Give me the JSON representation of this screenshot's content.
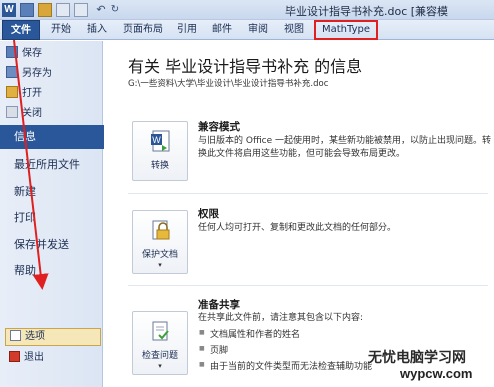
{
  "window": {
    "title": "毕业设计指导书补充.doc [兼容模"
  },
  "quick_access": {
    "logo": "W",
    "undo": "↶",
    "redo": "↻"
  },
  "ribbon_tabs": [
    "文件",
    "开始",
    "插入",
    "页面布局",
    "引用",
    "邮件",
    "审阅",
    "视图",
    "MathType"
  ],
  "backstage_nav": {
    "small_items": [
      "保存",
      "另存为",
      "打开",
      "关闭"
    ],
    "big_items": [
      "信息",
      "最近所用文件",
      "新建",
      "打印",
      "保存并发送",
      "帮助"
    ],
    "selected": "信息",
    "options_label": "选项",
    "exit_label": "退出"
  },
  "info": {
    "title": "有关 毕业设计指导书补充 的信息",
    "path": "G:\\一些资料\\大学\\毕业设计\\毕业设计指导书补充.doc",
    "compat": {
      "title": "兼容模式",
      "desc1": "与旧版本的 Office 一起使用时，某些新功能被禁用，以防止出现问题。转",
      "desc2": "换此文件将启用这些功能，但可能会导致布局更改。",
      "button_label": "转换"
    },
    "permissions": {
      "title": "权限",
      "desc": "任何人均可打开、复制和更改此文档的任何部分。",
      "button_label": "保护文档"
    },
    "prepare": {
      "title": "准备共享",
      "desc": "在共享此文件前，请注意其包含以下内容:",
      "bullets": [
        "文档属性和作者的姓名",
        "页脚",
        "由于当前的文件类型而无法检查辅助功能"
      ],
      "button_label": "检查问题"
    }
  },
  "watermark": {
    "cn": "无忧电脑学习网",
    "url": "wypcw.com"
  },
  "colors": {
    "accent": "#2a579a",
    "annotation": "#e02020"
  }
}
